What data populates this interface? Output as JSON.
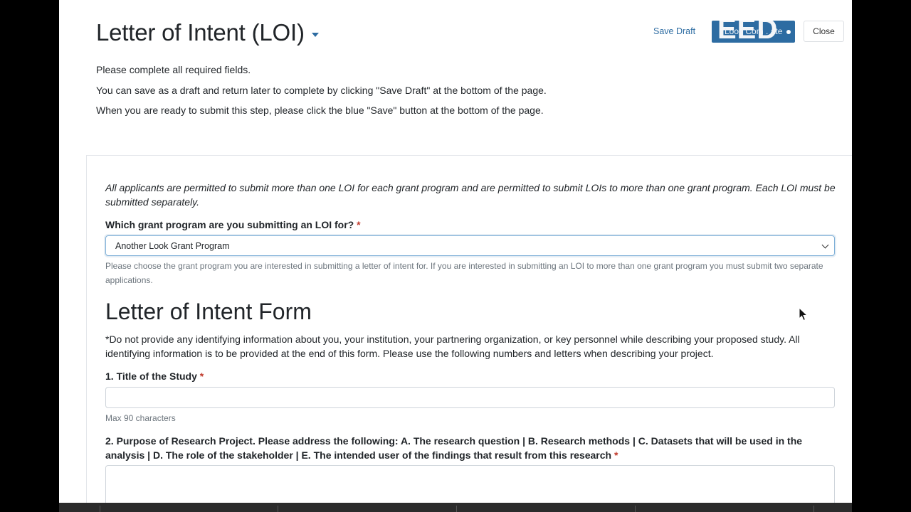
{
  "header": {
    "title": "Letter of Intent (LOI)",
    "save_draft": "Save Draft",
    "blue_button_ghost": "EED",
    "blue_button_label": "Look Com  .  ate",
    "close_button": "Close"
  },
  "intro": {
    "line1": "Please complete all required fields.",
    "line2": "You can save as a draft and return later to complete by clicking \"Save Draft\" at the bottom of the page.",
    "line3": "When you are ready to submit this step, please click the blue \"Save\" button at the bottom of the page."
  },
  "form": {
    "info": "All applicants are permitted to submit more than one LOI for each grant program and are permitted to submit LOIs to more than one grant program. Each LOI must be submitted separately.",
    "grant_question": "Which grant program are you submitting an LOI for?",
    "required_mark": "*",
    "grant_selected": "Another Look Grant Program",
    "grant_help": "Please choose the grant program you are interested in submitting a letter of intent for. If you are interested in submitting an LOI to more than one grant program you must submit two separate applications.",
    "section_title": "Letter of Intent Form",
    "section_desc": "*Do not provide any identifying information about you, your institution, your partnering organization, or key personnel while describing your proposed study. All identifying information is to be provided at the end of this form. Please use the following numbers and letters when describing your project.",
    "q1_label": "1. Title of the Study",
    "q1_value": "",
    "q1_help": "Max 90 characters",
    "q2_label": "2. Purpose of Research Project. Please address the following: A. The research question | B. Research methods | C. Datasets that will be used in the analysis | D. The role of the stakeholder | E. The intended user of the findings that result from this research",
    "q2_value": ""
  },
  "colors": {
    "accent": "#2d6ca2",
    "required": "#c0392b",
    "help_text": "#6c757d"
  },
  "icons": {
    "title_caret": "caret-down-icon",
    "select_chevron": "chevron-down-icon",
    "cursor": "mouse-pointer-icon"
  }
}
